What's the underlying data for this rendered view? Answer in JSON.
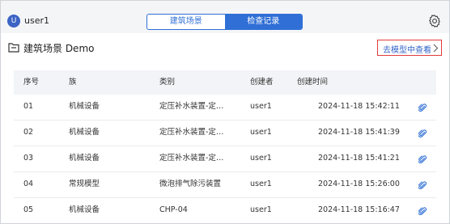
{
  "user": {
    "avatar_letter": "U",
    "name": "user1"
  },
  "tabs": [
    {
      "label": "建筑场景",
      "active": false
    },
    {
      "label": "检查记录",
      "active": true
    }
  ],
  "scene": {
    "title": "建筑场景 Demo",
    "open_model_label": "去模型中查看"
  },
  "table": {
    "headers": [
      "序号",
      "族",
      "类别",
      "创建者",
      "创建时间"
    ],
    "rows": [
      {
        "index": "01",
        "family": "机械设备",
        "category": "定压补水装置-定…",
        "creator": "user1",
        "time": "2024-11-18 15:42:11"
      },
      {
        "index": "02",
        "family": "机械设备",
        "category": "定压补水装置-定…",
        "creator": "user1",
        "time": "2024-11-18 15:41:39"
      },
      {
        "index": "03",
        "family": "机械设备",
        "category": "定压补水装置-定…",
        "creator": "user1",
        "time": "2024-11-18 15:41:21"
      },
      {
        "index": "04",
        "family": "常规模型",
        "category": "微泡排气除污装置",
        "creator": "user1",
        "time": "2024-11-18 15:26:00"
      },
      {
        "index": "05",
        "family": "机械设备",
        "category": "CHP-04",
        "creator": "user1",
        "time": "2024-11-18 15:16:47"
      }
    ]
  },
  "icons": {
    "settings": "gear-icon",
    "folder": "folder-icon",
    "chevron": "chevron-right-icon",
    "attachment": "paperclip-icon"
  },
  "colors": {
    "accent": "#2f6fd6",
    "highlight_border": "#e23b3b",
    "link": "#3565c8"
  }
}
